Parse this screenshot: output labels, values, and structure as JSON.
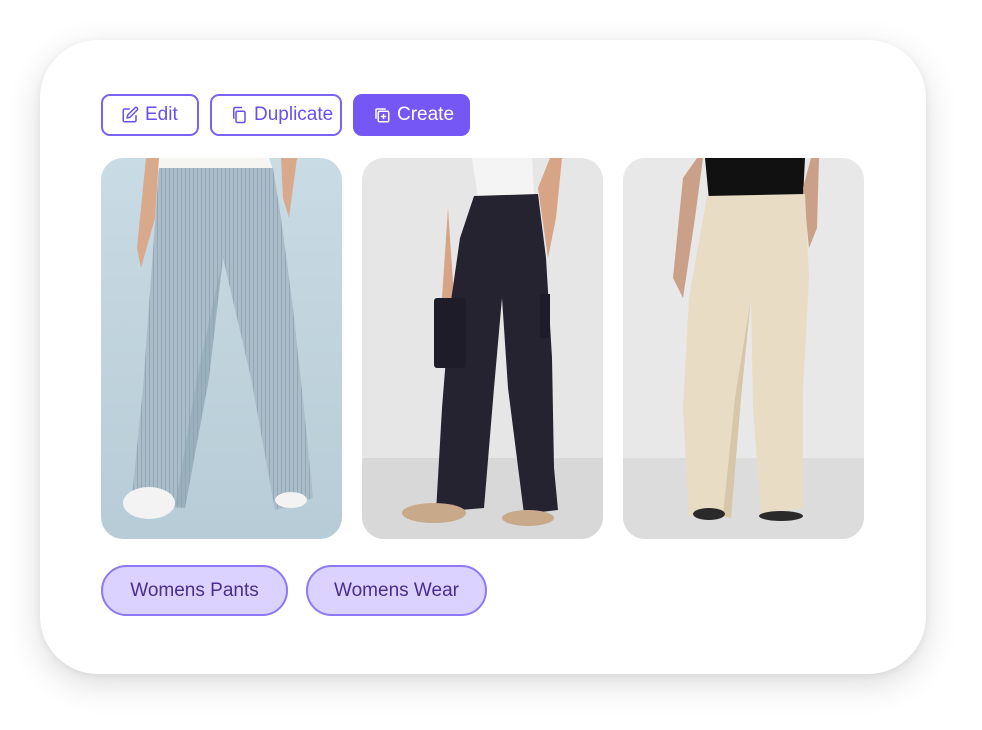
{
  "toolbar": {
    "edit_label": "Edit",
    "edit_icon": "edit-icon",
    "duplicate_label": "Duplicate",
    "duplicate_icon": "copy-icon",
    "create_label": "Create",
    "create_icon": "add-copy-icon"
  },
  "gallery": {
    "images": [
      {
        "description_icon": "light-blue-striped-wide-leg-pants"
      },
      {
        "description_icon": "black-cargo-wide-leg-pants"
      },
      {
        "description_icon": "beige-wide-leg-pants"
      }
    ]
  },
  "tags": [
    {
      "label": "Womens Pants"
    },
    {
      "label": "Womens Wear"
    }
  ],
  "colors": {
    "accent": "#7557f5",
    "tag_bg": "#dcd2ff",
    "tag_text": "#4a2d8c"
  }
}
